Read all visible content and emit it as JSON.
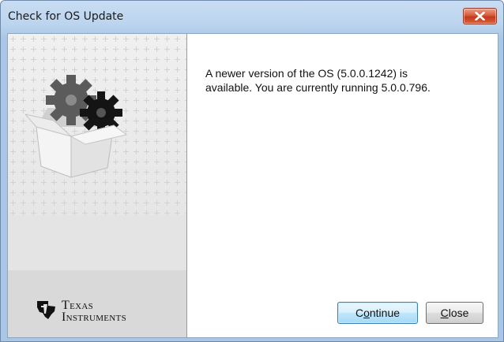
{
  "window": {
    "title": "Check for OS Update"
  },
  "message": {
    "line1": "A newer version of the OS (5.0.0.1242) is",
    "line2": "available. You are currently running 5.0.0.796."
  },
  "branding": {
    "logo_line1": "Texas",
    "logo_line2": "Instruments",
    "logo_icon": "ti-state-logo-icon",
    "illustration_icon": "gears-in-box-icon"
  },
  "buttons": {
    "continue_pre": "C",
    "continue_accel": "o",
    "continue_post": "ntinue",
    "close_pre": "",
    "close_accel": "C",
    "close_post": "lose"
  },
  "colors": {
    "titlebar": "#bcd4ee",
    "close_button": "#c2391b",
    "default_button_border": "#3c7fb1",
    "sidebar": "#e4e4e4"
  },
  "icons": {
    "close": "close-icon"
  }
}
